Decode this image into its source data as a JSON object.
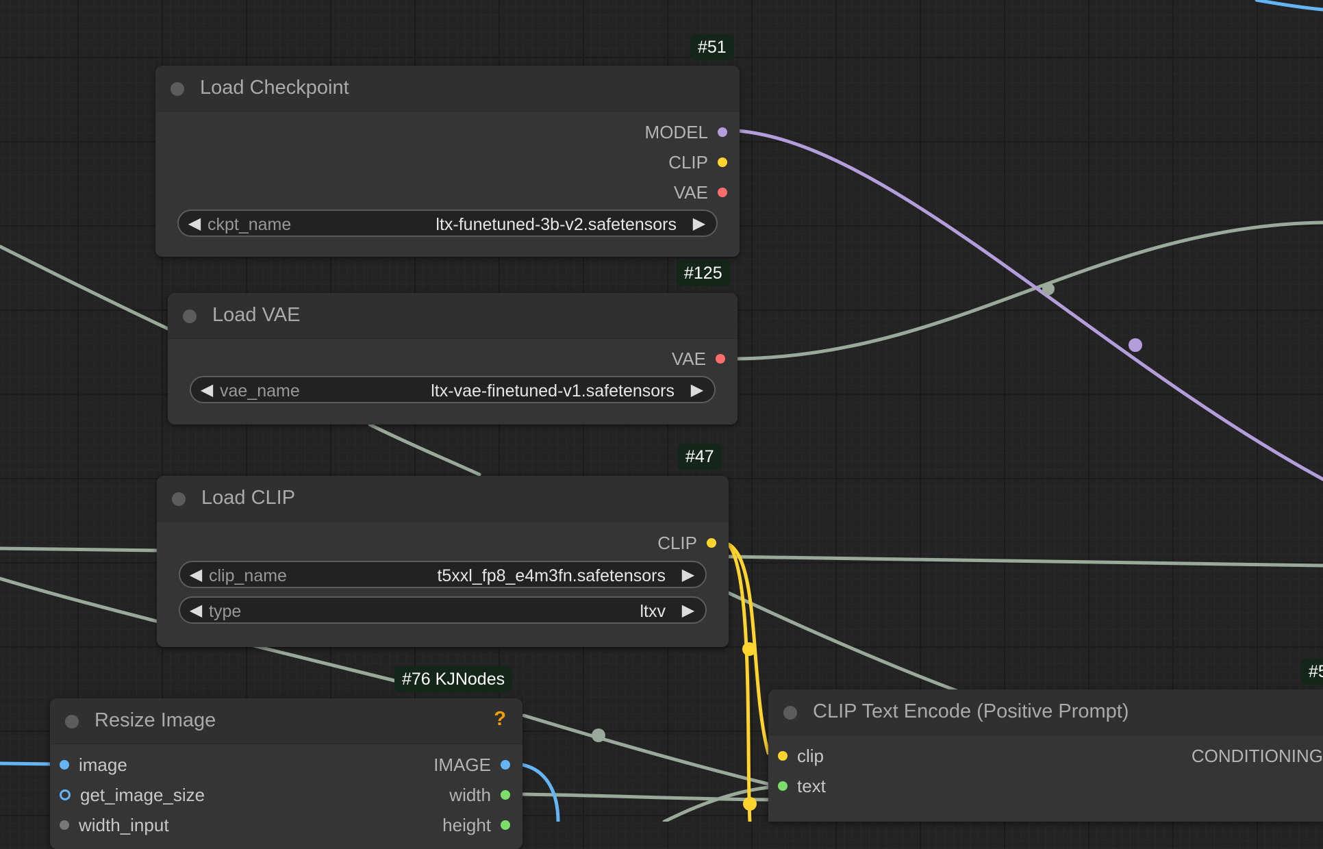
{
  "colors": {
    "model": "#b39ddb",
    "clip": "#ffd42e",
    "vae": "#ff6e6e",
    "image": "#64b5f6",
    "int": "#7cdd6a",
    "conditioning": "#ffa931",
    "link_default": "#9aaa9a"
  },
  "nodes": {
    "load_checkpoint": {
      "badge": "#51",
      "title": "Load Checkpoint",
      "outputs": [
        "MODEL",
        "CLIP",
        "VAE"
      ],
      "widgets": [
        {
          "name": "ckpt_name",
          "value": "ltx-funetuned-3b-v2.safetensors"
        }
      ]
    },
    "load_vae": {
      "badge": "#125",
      "title": "Load VAE",
      "outputs": [
        "VAE"
      ],
      "widgets": [
        {
          "name": "vae_name",
          "value": "ltx-vae-finetuned-v1.safetensors"
        }
      ]
    },
    "load_clip": {
      "badge": "#47",
      "title": "Load CLIP",
      "outputs": [
        "CLIP"
      ],
      "widgets": [
        {
          "name": "clip_name",
          "value": "t5xxl_fp8_e4m3fn.safetensors"
        },
        {
          "name": "type",
          "value": "ltxv"
        }
      ]
    },
    "resize_image": {
      "badge": "#76 KJNodes",
      "title": "Resize Image",
      "help": "?",
      "inputs": [
        "image",
        "get_image_size",
        "width_input"
      ],
      "outputs": [
        "IMAGE",
        "width",
        "height"
      ]
    },
    "clip_text_encode": {
      "badge": "#5",
      "title": "CLIP Text Encode (Positive Prompt)",
      "inputs": [
        "clip",
        "text"
      ],
      "outputs": [
        "CONDITIONING"
      ]
    }
  },
  "icons": {
    "arrow_left": "◀",
    "arrow_right": "▶"
  }
}
